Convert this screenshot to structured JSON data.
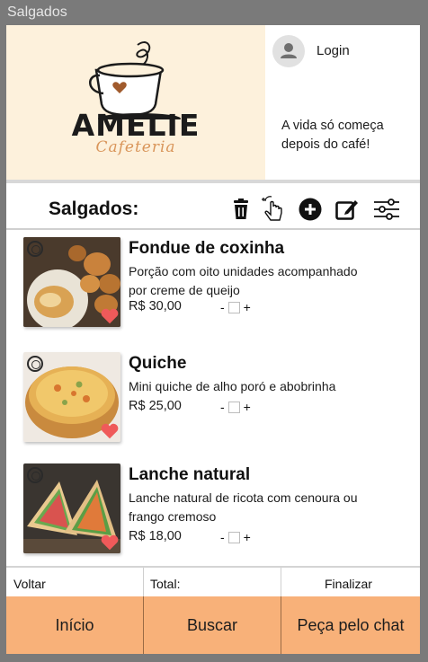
{
  "window": {
    "title": "Salgados"
  },
  "brand": {
    "name": "AMELIE",
    "subtitle": "Cafeteria"
  },
  "user": {
    "login_label": "Login",
    "tagline": "A vida só começa depois do café!"
  },
  "toolbar": {
    "title": "Salgados:",
    "icons": [
      "trash-icon",
      "tap-gesture-icon",
      "plus-circle-icon",
      "edit-icon",
      "filter-sliders-icon"
    ]
  },
  "products": [
    {
      "name": "Fondue de coxinha",
      "description": "Porção com oito unidades acompanhado por creme de queijo",
      "price": "R$ 30,00",
      "minus": "-",
      "plus": "+"
    },
    {
      "name": "Quiche",
      "description": "Mini quiche de alho poró e abobrinha",
      "price": "R$ 25,00",
      "minus": "-",
      "plus": "+"
    },
    {
      "name": "Lanche natural",
      "description": "Lanche natural de ricota com cenoura ou frango cremoso",
      "price": "R$ 18,00",
      "minus": "-",
      "plus": "+"
    }
  ],
  "summary": {
    "back": "Voltar",
    "total": "Total:",
    "finish": "Finalizar"
  },
  "nav": {
    "home": "Início",
    "search": "Buscar",
    "chat": "Peça pelo chat"
  },
  "colors": {
    "brand_bg": "#fdf1dc",
    "accent_orange": "#f8b179",
    "heart": "#ef5a5a",
    "subtitle": "#d9955a"
  }
}
